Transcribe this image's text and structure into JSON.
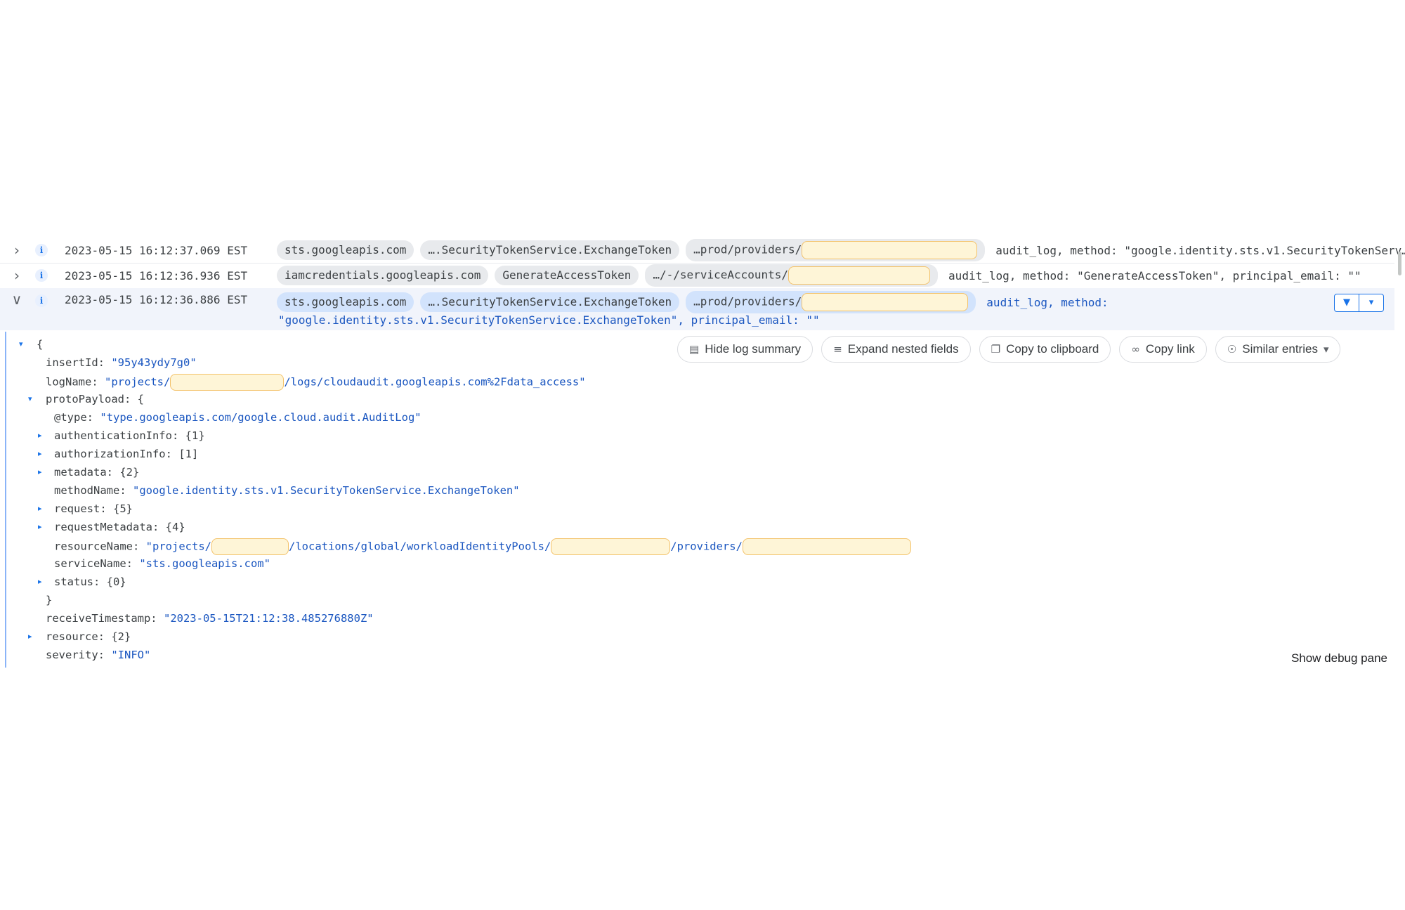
{
  "rows": [
    {
      "timestamp": "2023-05-15 16:12:37.069 EST",
      "chips": [
        "sts.googleapis.com",
        "….SecurityTokenService.ExchangeToken",
        "…prod/providers/"
      ],
      "summary": "audit_log, method: \"google.identity.sts.v1.SecurityTokenServ…"
    },
    {
      "timestamp": "2023-05-15 16:12:36.936 EST",
      "chips": [
        "iamcredentials.googleapis.com",
        "GenerateAccessToken",
        "…/-/serviceAccounts/"
      ],
      "summary": "audit_log, method: \"GenerateAccessToken\", principal_email: \"\""
    },
    {
      "timestamp": "2023-05-15 16:12:36.886 EST",
      "chips": [
        "sts.googleapis.com",
        "….SecurityTokenService.ExchangeToken",
        "…prod/providers/"
      ],
      "summary": "audit_log, method:",
      "summary_line2": "\"google.identity.sts.v1.SecurityTokenService.ExchangeToken\", principal_email: \"\""
    }
  ],
  "toolbar": {
    "hide_summary": "Hide log summary",
    "expand_nested": "Expand nested fields",
    "copy_clipboard": "Copy to clipboard",
    "copy_link": "Copy link",
    "similar_entries": "Similar entries"
  },
  "json": {
    "open_brace": "{",
    "close_brace": "}",
    "insertId_key": "insertId:",
    "insertId_val": "\"95y43ydy7g0\"",
    "logName_key": "logName:",
    "logName_pre": "\"projects/",
    "logName_post": "/logs/cloudaudit.googleapis.com%2Fdata_access\"",
    "protoPayload_key": "protoPayload:",
    "type_key": "@type:",
    "type_val": "\"type.googleapis.com/google.cloud.audit.AuditLog\"",
    "authenticationInfo": "authenticationInfo:",
    "authenticationInfo_val": "{1}",
    "authorizationInfo": "authorizationInfo:",
    "authorizationInfo_val": "[1]",
    "metadata": "metadata:",
    "metadata_val": "{2}",
    "methodName_key": "methodName:",
    "methodName_val": "\"google.identity.sts.v1.SecurityTokenService.ExchangeToken\"",
    "request": "request:",
    "request_val": "{5}",
    "requestMetadata": "requestMetadata:",
    "requestMetadata_val": "{4}",
    "resourceName_key": "resourceName:",
    "resourceName_p1": "\"projects/",
    "resourceName_p2": "/locations/global/workloadIdentityPools/",
    "resourceName_p3": "/providers/",
    "serviceName_key": "serviceName:",
    "serviceName_val": "\"sts.googleapis.com\"",
    "status": "status:",
    "status_val": "{0}",
    "receiveTimestamp_key": "receiveTimestamp:",
    "receiveTimestamp_val": "\"2023-05-15T21:12:38.485276880Z\"",
    "resource": "resource:",
    "resource_val": "{2}",
    "severity_key": "severity:",
    "severity_val": "\"INFO\""
  },
  "debug_pane": "Show debug pane",
  "icons": {
    "expand": "chevron-right-icon",
    "collapse": "chevron-down-icon",
    "severity": "info-icon",
    "pin": "pin-icon",
    "menu": "dropdown-icon"
  },
  "colors": {
    "selected_row_bg": "#f1f4fb",
    "chip_bg": "#e8eaed",
    "chip_selected_bg": "#d2e3fc",
    "value_blue": "#1a56c0",
    "redaction_fill": "#fef5d7",
    "redaction_border": "#f3c26a"
  }
}
